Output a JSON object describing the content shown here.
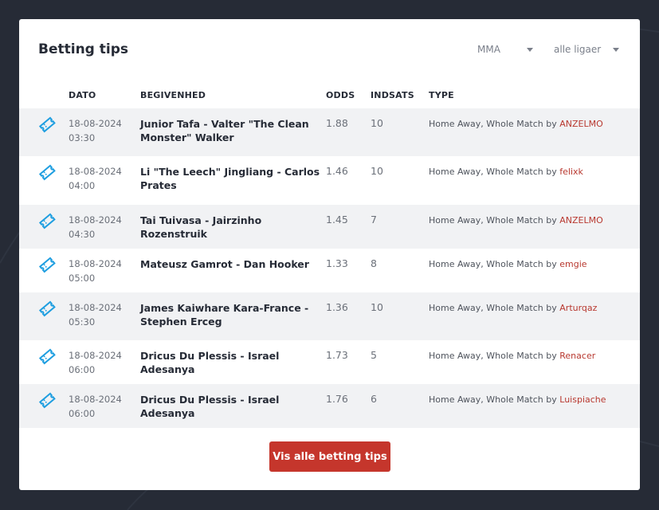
{
  "card": {
    "title": "Betting tips",
    "sport_select": "MMA",
    "league_select": "alle ligaer"
  },
  "table": {
    "headers": {
      "date": "DATO",
      "event": "BEGIVENHED",
      "odds": "ODDS",
      "stake": "INDSATS",
      "type": "TYPE"
    },
    "rows": [
      {
        "date": "18-08-2024",
        "time": "03:30",
        "event": "Junior Tafa - Valter \"The Clean Monster\" Walker",
        "odds": "1.88",
        "stake": "10",
        "type": "Home Away, Whole Match by",
        "user": "ANZELMO"
      },
      {
        "date": "18-08-2024",
        "time": "04:00",
        "event": "Li \"The Leech\" Jingliang - Carlos Prates",
        "odds": "1.46",
        "stake": "10",
        "type": "Home Away, Whole Match by",
        "user": "felixk"
      },
      {
        "date": "18-08-2024",
        "time": "04:30",
        "event": "Tai Tuivasa - Jairzinho Rozenstruik",
        "odds": "1.45",
        "stake": "7",
        "type": "Home Away, Whole Match by",
        "user": "ANZELMO"
      },
      {
        "date": "18-08-2024",
        "time": "05:00",
        "event": "Mateusz Gamrot - Dan Hooker",
        "odds": "1.33",
        "stake": "8",
        "type": "Home Away, Whole Match by",
        "user": "emgie"
      },
      {
        "date": "18-08-2024",
        "time": "05:30",
        "event": "James Kaiwhare Kara-France - Stephen Erceg",
        "odds": "1.36",
        "stake": "10",
        "type": "Home Away, Whole Match by",
        "user": "Arturqaz"
      },
      {
        "date": "18-08-2024",
        "time": "06:00",
        "event": "Dricus Du Plessis - Israel Adesanya",
        "odds": "1.73",
        "stake": "5",
        "type": "Home Away, Whole Match by",
        "user": "Renacer"
      },
      {
        "date": "18-08-2024",
        "time": "06:00",
        "event": "Dricus Du Plessis - Israel Adesanya",
        "odds": "1.76",
        "stake": "6",
        "type": "Home Away, Whole Match by",
        "user": "Luispiache"
      }
    ]
  },
  "button": {
    "label": "Vis alle betting tips"
  },
  "icons": {
    "row_icon": "ticket-icon",
    "dropdown": "chevron-down-icon"
  },
  "colors": {
    "accent": "#c5362c",
    "link": "#b8382f",
    "icon": "#1e9ee0",
    "background": "#262b36"
  }
}
